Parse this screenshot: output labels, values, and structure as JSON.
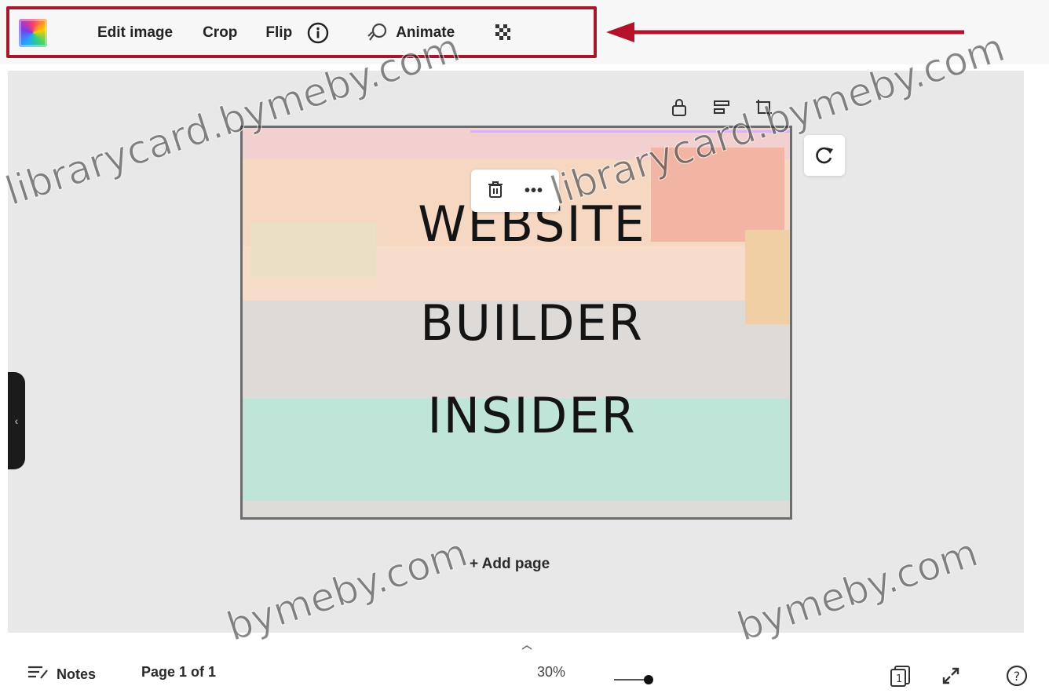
{
  "toolbar": {
    "edit_image_label": "Edit image",
    "crop_label": "Crop",
    "flip_label": "Flip",
    "animate_label": "Animate",
    "highlight_color": "#a3172f"
  },
  "design": {
    "lines": [
      "WEBSITE",
      "BUILDER",
      "INSIDER"
    ]
  },
  "canvas": {
    "add_page_label": "+ Add page"
  },
  "footer": {
    "notes_label": "Notes",
    "page_info": "Page 1 of 1",
    "zoom_level": "30%",
    "page_count_badge": "1",
    "help_label": "?"
  },
  "watermark": {
    "text_full": "librarycard.bymeby.com",
    "text_short": "bymeby.com"
  },
  "icons": {
    "info": "info-icon",
    "animate": "animate-icon",
    "transparency": "transparency-icon",
    "lock": "lock-icon",
    "align": "align-icon",
    "resize": "resize-icon",
    "trash": "trash-icon",
    "more": "more-icon",
    "rotate": "rotate-icon",
    "notes": "notes-icon",
    "grid_view": "grid-view-icon",
    "fullscreen": "fullscreen-icon",
    "help": "help-icon"
  }
}
